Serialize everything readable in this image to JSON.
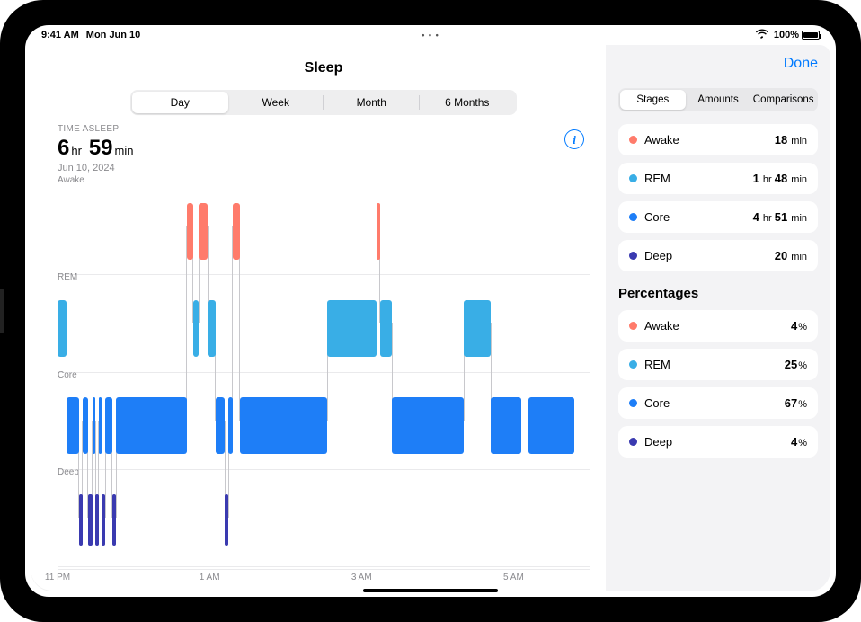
{
  "status": {
    "time": "9:41 AM",
    "date": "Mon Jun 10",
    "battery": "100%"
  },
  "header": {
    "title": "Sleep",
    "done": "Done"
  },
  "range_tabs": [
    "Day",
    "Week",
    "Month",
    "6 Months"
  ],
  "range_selected": 0,
  "summary": {
    "label": "TIME ASLEEP",
    "hr_num": "6",
    "hr_unit": "hr",
    "min_num": "59",
    "min_unit": "min",
    "date": "Jun 10, 2024"
  },
  "sidebar": {
    "tabs": [
      "Stages",
      "Amounts",
      "Comparisons"
    ],
    "tab_selected": 0,
    "stage_durations": [
      {
        "name": "Awake",
        "color": "#ff7b6b",
        "value_html": [
          [
            "18",
            "b"
          ],
          [
            " min",
            "u"
          ]
        ]
      },
      {
        "name": "REM",
        "color": "#39aee6",
        "value_html": [
          [
            "1",
            "b"
          ],
          [
            " hr ",
            "u"
          ],
          [
            "48",
            "b"
          ],
          [
            " min",
            "u"
          ]
        ]
      },
      {
        "name": "Core",
        "color": "#1e7ef7",
        "value_html": [
          [
            "4",
            "b"
          ],
          [
            " hr ",
            "u"
          ],
          [
            "51",
            "b"
          ],
          [
            " min",
            "u"
          ]
        ]
      },
      {
        "name": "Deep",
        "color": "#3a3ab0",
        "value_html": [
          [
            "20",
            "b"
          ],
          [
            " min",
            "u"
          ]
        ]
      }
    ],
    "pct_header": "Percentages",
    "stage_percentages": [
      {
        "name": "Awake",
        "color": "#ff7b6b",
        "pct": "4%"
      },
      {
        "name": "REM",
        "color": "#39aee6",
        "pct": "25%"
      },
      {
        "name": "Core",
        "color": "#1e7ef7",
        "pct": "67%"
      },
      {
        "name": "Deep",
        "color": "#3a3ab0",
        "pct": "4%"
      }
    ]
  },
  "chart_data": {
    "type": "sleep-stage-timeline",
    "title": "Sleep",
    "lanes": [
      "Awake",
      "REM",
      "Core",
      "Deep"
    ],
    "lane_colors": {
      "Awake": "#ff7b6b",
      "REM": "#39aee6",
      "Core": "#1e7ef7",
      "Deep": "#3a3ab0"
    },
    "x_unit": "hour_of_night",
    "x_range": [
      23.0,
      30.0
    ],
    "x_ticks": [
      {
        "value": 23.0,
        "label": "11 PM"
      },
      {
        "value": 25.0,
        "label": "1 AM"
      },
      {
        "value": 27.0,
        "label": "3 AM"
      },
      {
        "value": 29.0,
        "label": "5 AM"
      }
    ],
    "segments": [
      {
        "lane": "REM",
        "start": 23.0,
        "end": 23.12
      },
      {
        "lane": "Core",
        "start": 23.12,
        "end": 23.28
      },
      {
        "lane": "Deep",
        "start": 23.28,
        "end": 23.33
      },
      {
        "lane": "Core",
        "start": 23.33,
        "end": 23.4
      },
      {
        "lane": "Deep",
        "start": 23.4,
        "end": 23.46
      },
      {
        "lane": "Core",
        "start": 23.46,
        "end": 23.5
      },
      {
        "lane": "Deep",
        "start": 23.5,
        "end": 23.54
      },
      {
        "lane": "Core",
        "start": 23.54,
        "end": 23.58
      },
      {
        "lane": "Deep",
        "start": 23.58,
        "end": 23.63
      },
      {
        "lane": "Core",
        "start": 23.63,
        "end": 23.72
      },
      {
        "lane": "Deep",
        "start": 23.72,
        "end": 23.77
      },
      {
        "lane": "Core",
        "start": 23.77,
        "end": 24.7
      },
      {
        "lane": "Awake",
        "start": 24.7,
        "end": 24.78
      },
      {
        "lane": "REM",
        "start": 24.78,
        "end": 24.86
      },
      {
        "lane": "Awake",
        "start": 24.86,
        "end": 24.98
      },
      {
        "lane": "REM",
        "start": 24.98,
        "end": 25.08
      },
      {
        "lane": "Core",
        "start": 25.08,
        "end": 25.2
      },
      {
        "lane": "Deep",
        "start": 25.2,
        "end": 25.25
      },
      {
        "lane": "Core",
        "start": 25.25,
        "end": 25.3
      },
      {
        "lane": "Awake",
        "start": 25.3,
        "end": 25.4
      },
      {
        "lane": "Core",
        "start": 25.4,
        "end": 26.55
      },
      {
        "lane": "REM",
        "start": 26.55,
        "end": 27.2
      },
      {
        "lane": "Awake",
        "start": 27.2,
        "end": 27.24
      },
      {
        "lane": "REM",
        "start": 27.24,
        "end": 27.4
      },
      {
        "lane": "Core",
        "start": 27.4,
        "end": 28.35
      },
      {
        "lane": "REM",
        "start": 28.35,
        "end": 28.7
      },
      {
        "lane": "Core",
        "start": 28.7,
        "end": 29.1
      },
      {
        "lane": "Core",
        "start": 29.2,
        "end": 29.8
      }
    ]
  }
}
